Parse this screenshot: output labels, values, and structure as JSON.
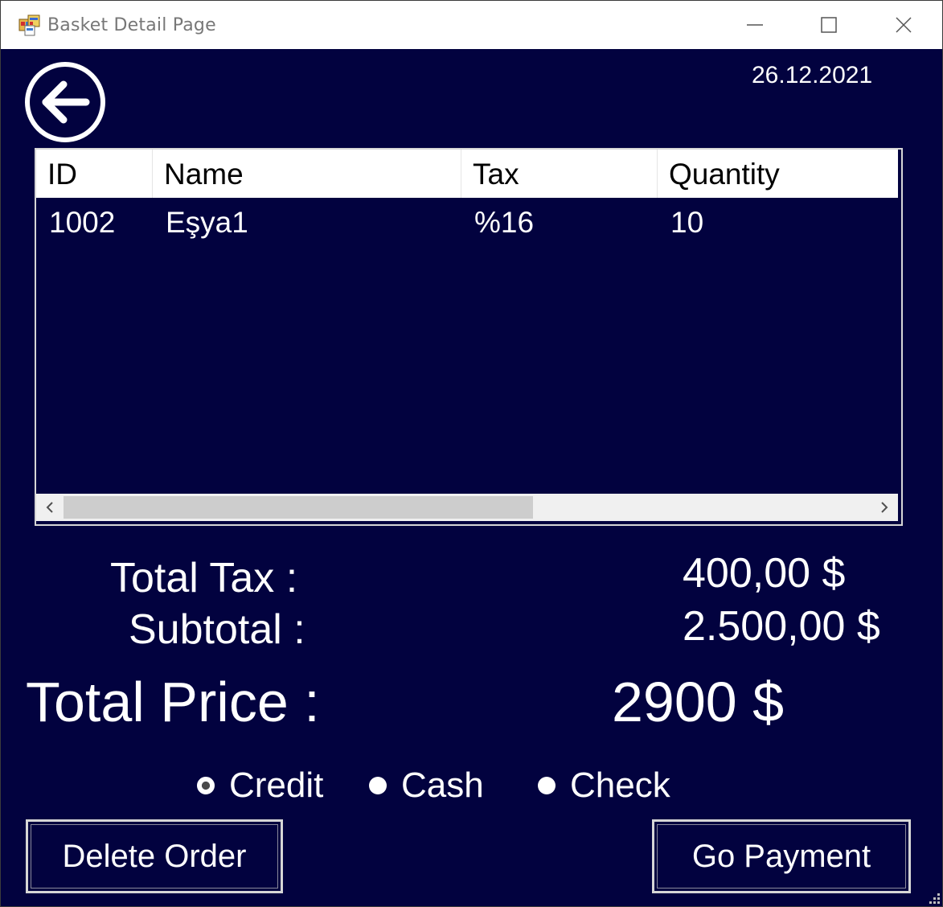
{
  "window": {
    "title": "Basket Detail Page",
    "icon": "winforms-app-icon"
  },
  "titlebar_buttons": [
    "minimize-icon",
    "maximize-icon",
    "close-icon"
  ],
  "header": {
    "date": "26.12.2021",
    "back_icon": "arrow-left-circle-icon"
  },
  "table": {
    "columns": [
      "ID",
      "Name",
      "Tax",
      "Quantity"
    ],
    "rows": [
      [
        "1002",
        "Eşya1",
        "%16",
        "10"
      ]
    ]
  },
  "totals": {
    "total_tax_label": "Total Tax :",
    "total_tax_value": "400,00 $",
    "subtotal_label": "Subtotal :",
    "subtotal_value": "2.500,00 $",
    "total_price_label": "Total Price :",
    "total_price_value": "2900 $"
  },
  "payment_methods": {
    "options": [
      "Credit",
      "Cash",
      "Check"
    ],
    "selected": "Credit"
  },
  "actions": {
    "delete_label": "Delete Order",
    "payment_label": "Go Payment"
  },
  "colors": {
    "background": "#02023f",
    "foreground": "#ffffff",
    "header_bg": "#ffffff"
  }
}
